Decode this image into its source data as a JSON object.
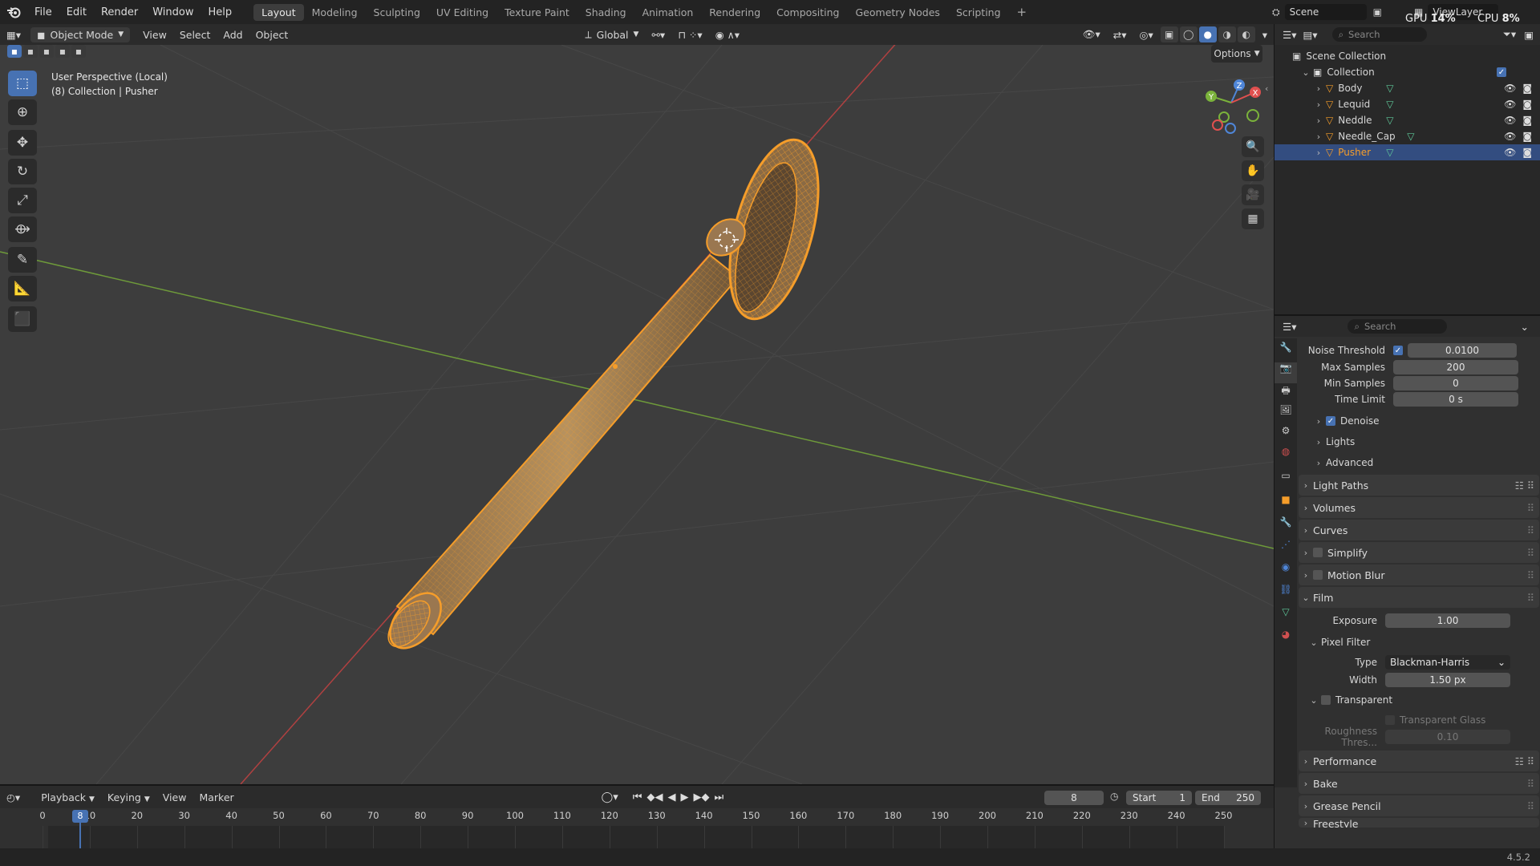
{
  "topbar": {
    "menus": [
      "File",
      "Edit",
      "Render",
      "Window",
      "Help"
    ],
    "workspaces": [
      "Layout",
      "Modeling",
      "Sculpting",
      "UV Editing",
      "Texture Paint",
      "Shading",
      "Animation",
      "Rendering",
      "Compositing",
      "Geometry Nodes",
      "Scripting"
    ],
    "active_workspace": "Layout",
    "add_tab": "+",
    "scene": "Scene",
    "view_layer": "ViewLayer",
    "gpu_label": "GPU",
    "gpu_value": "14%",
    "cpu_label": "CPU",
    "cpu_value": "8%"
  },
  "viewport_header": {
    "mode": "Object Mode",
    "menus": [
      "View",
      "Select",
      "Add",
      "Object"
    ],
    "orientation": "Global",
    "options": "Options"
  },
  "viewport": {
    "overlay_line1": "User Perspective (Local)",
    "overlay_line2": "(8) Collection | Pusher",
    "gizmo": {
      "x": "X",
      "y": "Y",
      "z": "Z"
    }
  },
  "outliner": {
    "search_placeholder": "Search",
    "scene_collection": "Scene Collection",
    "collection": "Collection",
    "objects": [
      {
        "name": "Body",
        "selected": false
      },
      {
        "name": "Lequid",
        "selected": false
      },
      {
        "name": "Neddle",
        "selected": false
      },
      {
        "name": "Needle_Cap",
        "selected": false
      },
      {
        "name": "Pusher",
        "selected": true
      }
    ]
  },
  "properties": {
    "search_placeholder": "Search",
    "noise_threshold_label": "Noise Threshold",
    "noise_threshold": "0.0100",
    "max_samples_label": "Max Samples",
    "max_samples": "200",
    "min_samples_label": "Min Samples",
    "min_samples": "0",
    "time_limit_label": "Time Limit",
    "time_limit": "0 s",
    "denoise": "Denoise",
    "lights": "Lights",
    "advanced": "Advanced",
    "panels": [
      "Light Paths",
      "Volumes",
      "Curves",
      "Simplify",
      "Motion Blur"
    ],
    "film": "Film",
    "exposure_label": "Exposure",
    "exposure": "1.00",
    "pixel_filter": "Pixel Filter",
    "type_label": "Type",
    "type_value": "Blackman-Harris",
    "width_label": "Width",
    "width_value": "1.50 px",
    "transparent": "Transparent",
    "transparent_glass": "Transparent Glass",
    "roughness_label": "Roughness Thres...",
    "roughness_value": "0.10",
    "bottom_panels": [
      "Performance",
      "Bake",
      "Grease Pencil",
      "Freestyle"
    ]
  },
  "timeline": {
    "menus": [
      "Playback",
      "Keying",
      "View",
      "Marker"
    ],
    "current_frame": "8",
    "start_label": "Start",
    "start": "1",
    "end_label": "End",
    "end": "250",
    "ticks": [
      "0",
      "10",
      "20",
      "30",
      "40",
      "50",
      "60",
      "70",
      "80",
      "90",
      "100",
      "110",
      "120",
      "130",
      "140",
      "150",
      "160",
      "170",
      "180",
      "190",
      "200",
      "210",
      "220",
      "230",
      "240",
      "250"
    ],
    "playhead": "8"
  },
  "statusbar": {
    "version": "4.5.2"
  },
  "colors": {
    "accent": "#4772b3",
    "selection_orange": "#f59d2a",
    "x_axis": "#b04141",
    "y_axis": "#6e9a3a"
  }
}
